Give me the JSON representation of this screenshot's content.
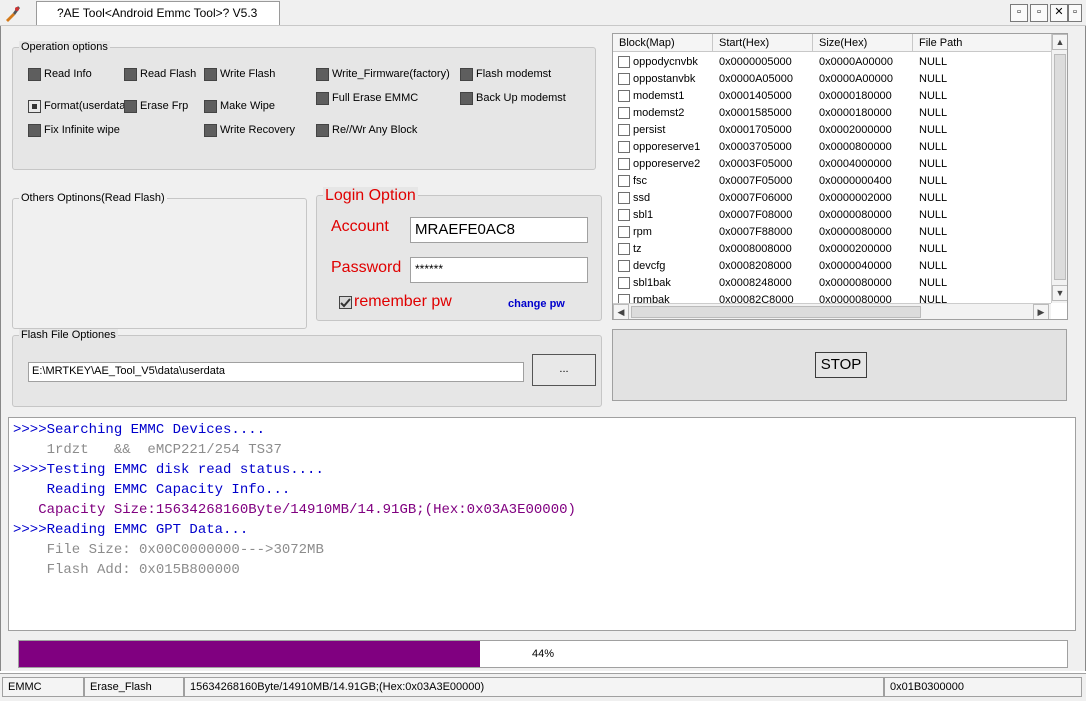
{
  "window": {
    "title": "?AE Tool<Android Emmc Tool>? V5.3",
    "minimize_icon": "minimize-icon",
    "restore_icon": "restore-icon",
    "close_icon": "close-icon"
  },
  "operation_options": {
    "legend": "Operation options",
    "items": [
      {
        "label": "Read Info",
        "checked": false
      },
      {
        "label": "Read Flash",
        "checked": false
      },
      {
        "label": "Write Flash",
        "checked": false
      },
      {
        "label": "Write_Firmware(factory)",
        "checked": false
      },
      {
        "label": "Flash modemst",
        "checked": false
      },
      {
        "label": "Format(userdata)",
        "checked": true
      },
      {
        "label": "Erase Frp",
        "checked": false
      },
      {
        "label": "Make Wipe",
        "checked": false
      },
      {
        "label": "Full Erase EMMC",
        "checked": false
      },
      {
        "label": "Back Up modemst",
        "checked": false
      },
      {
        "label": "Fix Infinite wipe",
        "checked": false
      },
      {
        "label": "Write Recovery",
        "checked": false
      },
      {
        "label": "Re//Wr Any Block",
        "checked": false
      }
    ]
  },
  "others_options": {
    "legend": "Others Optinons(Read Flash)"
  },
  "login": {
    "legend": "Login Option",
    "account_label": "Account",
    "account_value": "MRAEFE0AC8",
    "password_label": "Password",
    "password_value": "******",
    "remember_label": "remember pw",
    "remember_checked": true,
    "change_pw": "change pw"
  },
  "flash_file": {
    "legend": "Flash File Optiones",
    "path": "E:\\MRTKEY\\AE_Tool_V5\\data\\userdata",
    "browse_label": "..."
  },
  "block_table": {
    "columns": [
      "Block(Map)",
      "Start(Hex)",
      "Size(Hex)",
      "File Path"
    ],
    "rows": [
      [
        "oppodycnvbk",
        "0x0000005000",
        "0x0000A00000",
        "NULL"
      ],
      [
        "oppostanvbk",
        "0x0000A05000",
        "0x0000A00000",
        "NULL"
      ],
      [
        "modemst1",
        "0x0001405000",
        "0x0000180000",
        "NULL"
      ],
      [
        "modemst2",
        "0x0001585000",
        "0x0000180000",
        "NULL"
      ],
      [
        "persist",
        "0x0001705000",
        "0x0002000000",
        "NULL"
      ],
      [
        "opporeserve1",
        "0x0003705000",
        "0x0000800000",
        "NULL"
      ],
      [
        "opporeserve2",
        "0x0003F05000",
        "0x0004000000",
        "NULL"
      ],
      [
        "fsc",
        "0x0007F05000",
        "0x0000000400",
        "NULL"
      ],
      [
        "ssd",
        "0x0007F06000",
        "0x0000002000",
        "NULL"
      ],
      [
        "sbl1",
        "0x0007F08000",
        "0x0000080000",
        "NULL"
      ],
      [
        "rpm",
        "0x0007F88000",
        "0x0000080000",
        "NULL"
      ],
      [
        "tz",
        "0x0008008000",
        "0x0000200000",
        "NULL"
      ],
      [
        "devcfg",
        "0x0008208000",
        "0x0000040000",
        "NULL"
      ],
      [
        "sbl1bak",
        "0x0008248000",
        "0x0000080000",
        "NULL"
      ],
      [
        "rpmbak",
        "0x00082C8000",
        "0x0000080000",
        "NULL"
      ]
    ]
  },
  "stop_label": "STOP",
  "log": [
    {
      "text": ">>>>Searching EMMC Devices....",
      "color": "#0000cc"
    },
    {
      "text": "    1rdzt   &&  eMCP221/254 TS37",
      "color": "#8c8c8c"
    },
    {
      "text": ">>>>Testing EMMC disk read status....",
      "color": "#0000cc"
    },
    {
      "text": "    Reading EMMC Capacity Info...",
      "color": "#0000cc"
    },
    {
      "text": "   Capacity Size:15634268160Byte/14910MB/14.91GB;(Hex:0x03A3E00000)",
      "color": "#800080"
    },
    {
      "text": ">>>>Reading EMMC GPT Data...",
      "color": "#0000cc"
    },
    {
      "text": "    File Size: 0x00C0000000--->3072MB",
      "color": "#8c8c8c"
    },
    {
      "text": "    Flash Add: 0x015B800000",
      "color": "#8c8c8c"
    }
  ],
  "progress": {
    "fraction": 0.44,
    "label": "44%",
    "color": "#800080"
  },
  "status": {
    "mode": "EMMC",
    "operation": "Erase_Flash",
    "capacity": "15634268160Byte/14910MB/14.91GB;(Hex:0x03A3E00000)",
    "address": "0x01B0300000"
  },
  "colors": {
    "login_red": "#e00000",
    "link_blue": "#0000cc"
  }
}
